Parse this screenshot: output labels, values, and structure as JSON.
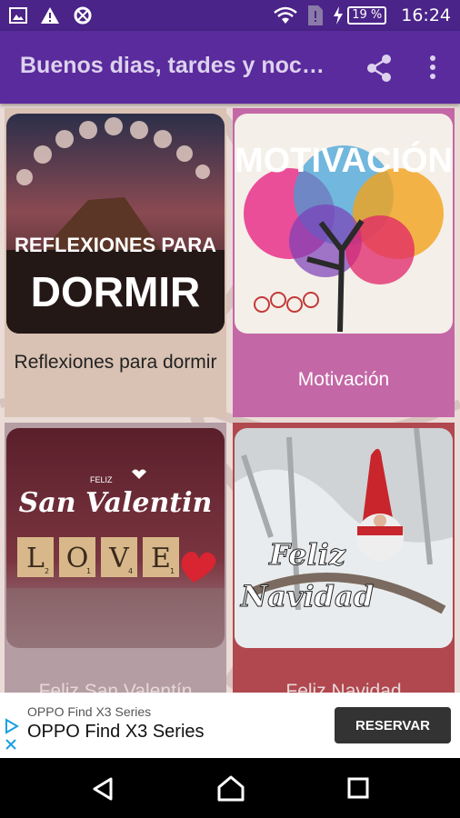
{
  "status_bar": {
    "battery_percent": "19 %",
    "time": "16:24",
    "icons": [
      "image-icon",
      "warning-icon",
      "data-saver-icon",
      "wifi-icon",
      "sim-alert-icon",
      "charging-icon"
    ]
  },
  "app_bar": {
    "title": "Buenos dias, tardes y noc…",
    "actions": [
      "share-icon",
      "more-vert-icon"
    ]
  },
  "grid": {
    "items": [
      {
        "label": "Reflexiones para dormir",
        "image_text_top": "REFLEXIONES PARA",
        "image_text_bottom": "DORMIR"
      },
      {
        "label": "Motivación",
        "image_text": "MOTIVACIÓN"
      },
      {
        "label": "Feliz San Valentín",
        "image_text_small": "FELIZ",
        "image_text": "San Valentin",
        "tiles": [
          "L",
          "O",
          "V",
          "E"
        ],
        "tile_numbers": [
          "2",
          "1",
          "4",
          "1"
        ]
      },
      {
        "label": "Feliz Navidad",
        "image_text_top": "Feliz",
        "image_text_bottom": "Navidad"
      }
    ]
  },
  "ad": {
    "small_text": "OPPO Find X3 Series",
    "title": "OPPO Find X3 Series",
    "button": "RESERVAR"
  },
  "colors": {
    "status_bar": "#4a2488",
    "app_bar": "#5a2b9c",
    "card_motivacion": "#c467a6",
    "card_navidad": "#b1484f"
  },
  "nav_bar": {
    "buttons": [
      "back-icon",
      "home-icon",
      "recents-icon"
    ]
  }
}
